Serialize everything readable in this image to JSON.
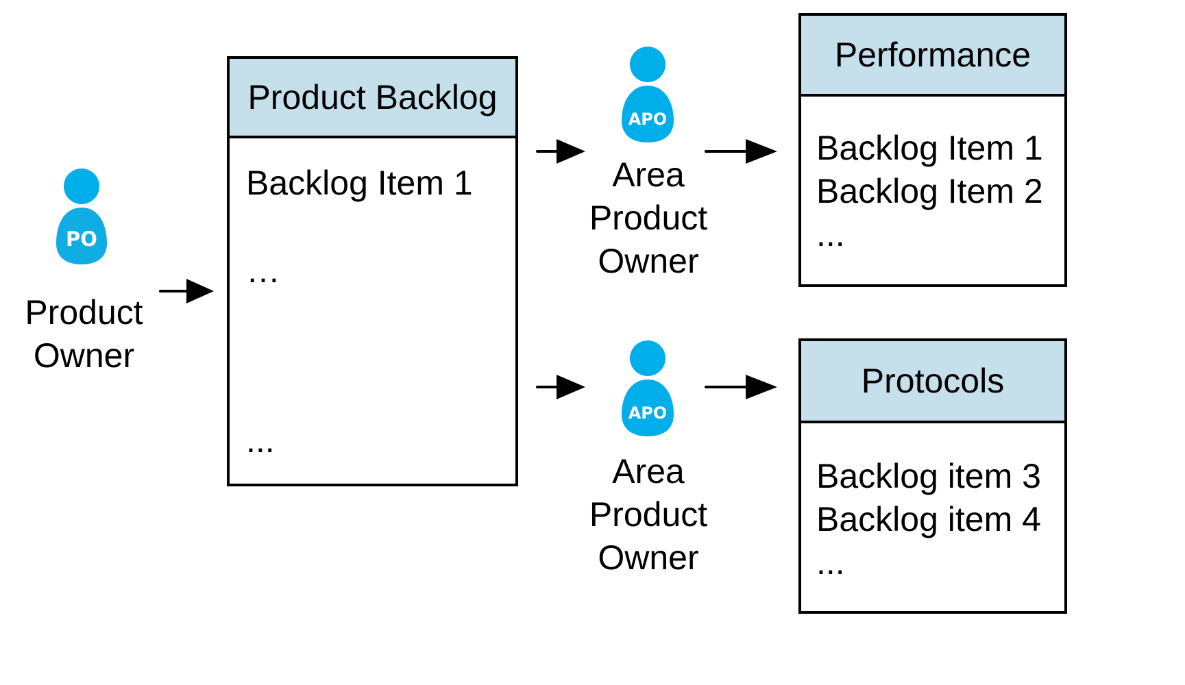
{
  "colors": {
    "person": "#00aee9",
    "header": "#c5dfeb",
    "stroke": "#000000"
  },
  "product_owner": {
    "badge": "PO",
    "label_lines": [
      "Product",
      "Owner"
    ],
    "icon": "person-icon"
  },
  "product_backlog": {
    "title": "Product Backlog",
    "items": [
      "Backlog Item 1",
      "…",
      "..."
    ]
  },
  "area_owners": [
    {
      "badge": "APO",
      "label_lines": [
        "Area",
        "Product",
        "Owner"
      ],
      "icon": "person-icon"
    },
    {
      "badge": "APO",
      "label_lines": [
        "Area",
        "Product",
        "Owner"
      ],
      "icon": "person-icon"
    }
  ],
  "area_backlogs": [
    {
      "title": "Performance",
      "items": [
        "Backlog Item 1",
        "Backlog Item 2",
        "..."
      ]
    },
    {
      "title": "Protocols",
      "items": [
        "Backlog item 3",
        "Backlog item 4",
        "..."
      ]
    }
  ],
  "arrows": [
    {
      "from": "Product Owner",
      "to": "Product Backlog"
    },
    {
      "from": "Product Backlog",
      "to": "Area Product Owner (Performance)"
    },
    {
      "from": "Area Product Owner (Performance)",
      "to": "Performance"
    },
    {
      "from": "Product Backlog",
      "to": "Area Product Owner (Protocols)"
    },
    {
      "from": "Area Product Owner (Protocols)",
      "to": "Protocols"
    }
  ]
}
